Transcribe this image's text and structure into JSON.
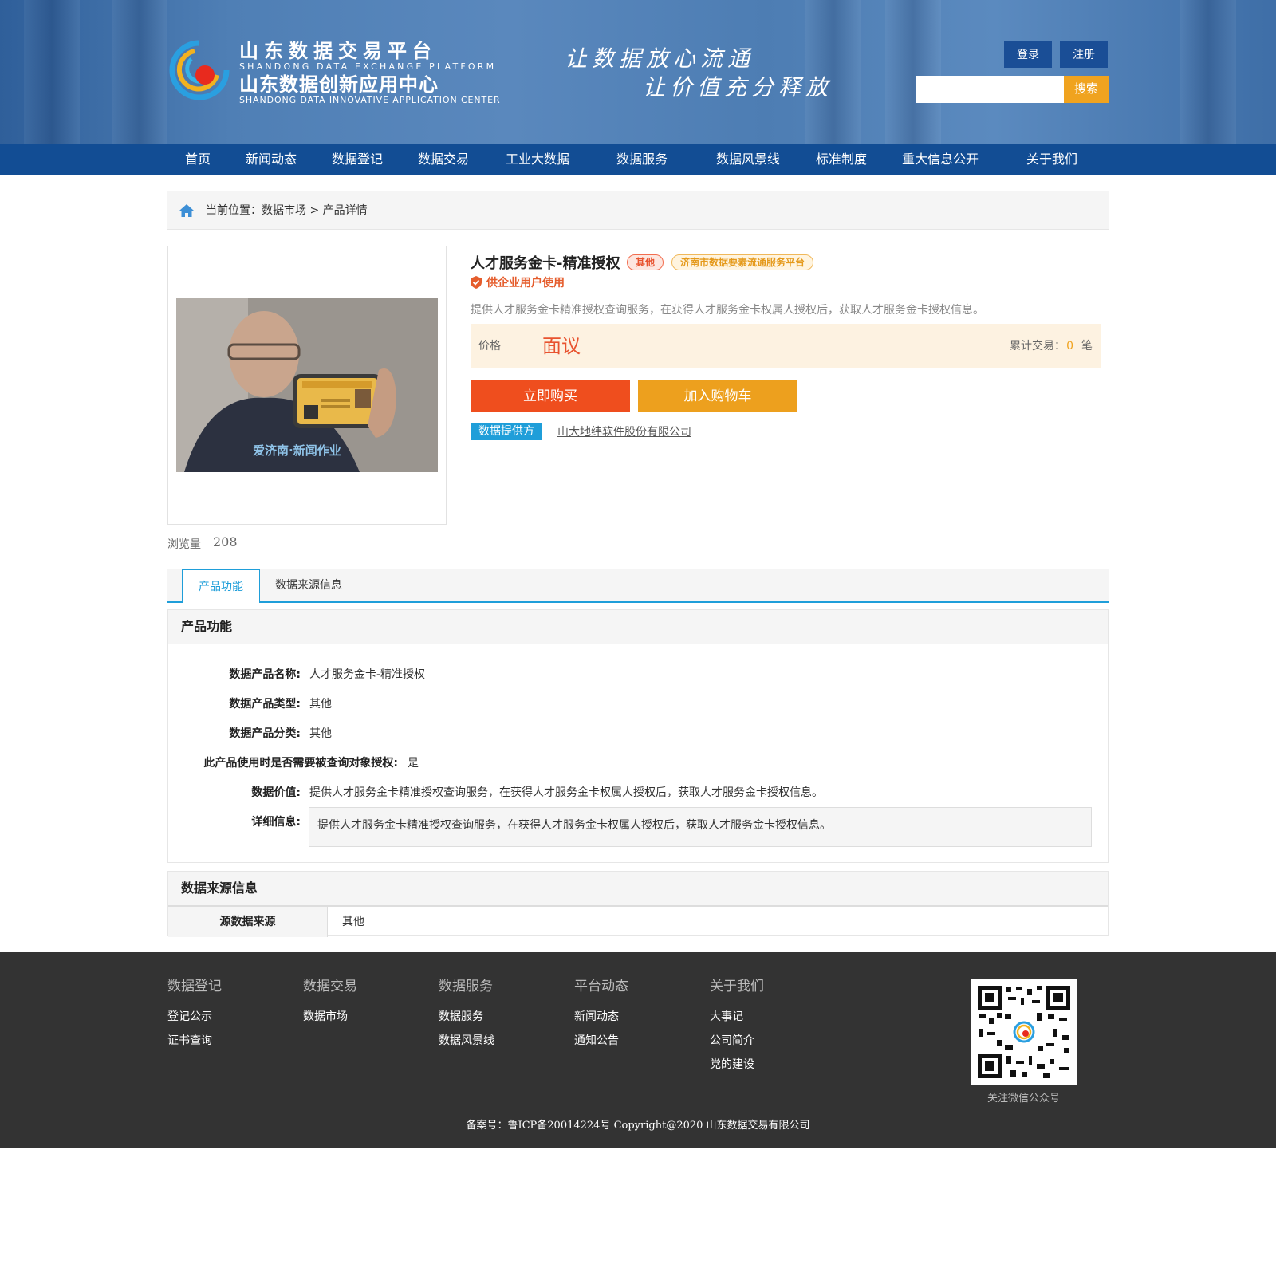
{
  "header": {
    "logo_cn_1": "山东数据交易平台",
    "logo_en_1": "SHANDONG DATA EXCHANGE PLATFORM",
    "logo_cn_2": "山东数据创新应用中心",
    "logo_en_2": "SHANDONG DATA INNOVATIVE APPLICATION CENTER",
    "slogan_1": "让数据放心流通",
    "slogan_2": "让价值充分释放",
    "login": "登录",
    "register": "注册",
    "search_button": "搜索",
    "search_placeholder": ""
  },
  "nav": [
    "首页",
    "新闻动态",
    "数据登记",
    "数据交易",
    "工业大数据",
    "数据服务",
    "数据风景线",
    "标准制度",
    "重大信息公开",
    "关于我们"
  ],
  "breadcrumb": {
    "prefix": "当前位置：",
    "market": "数据市场",
    "sep": " > ",
    "current": "产品详情"
  },
  "product": {
    "title": "人才服务金卡-精准授权",
    "tag_type": "其他",
    "tag_platform": "济南市数据要素流通服务平台",
    "usage": "供企业用户使用",
    "description": "提供人才服务金卡精准授权查询服务，在获得人才服务金卡权属人授权后，获取人才服务金卡授权信息。",
    "price_label": "价格",
    "price_value": "面议",
    "trade_label": "累计交易：",
    "trade_count": "0",
    "trade_unit": "笔",
    "buy_button": "立即购买",
    "cart_button": "加入购物车",
    "provider_label": "数据提供方",
    "provider_name": "山大地纬软件股份有限公司",
    "image_watermark": "爱济南·新闻作业",
    "views_label": "浏览量",
    "views_value": "208"
  },
  "tabs": [
    "产品功能",
    "数据来源信息"
  ],
  "function_section": {
    "title": "产品功能",
    "rows": [
      {
        "label": "数据产品名称:",
        "value": "人才服务金卡-精准授权"
      },
      {
        "label": "数据产品类型:",
        "value": "其他"
      },
      {
        "label": "数据产品分类:",
        "value": "其他"
      },
      {
        "label": "此产品使用时是否需要被查询对象授权:",
        "value": "是"
      },
      {
        "label": "数据价值:",
        "value": "提供人才服务金卡精准授权查询服务，在获得人才服务金卡权属人授权后，获取人才服务金卡授权信息。"
      },
      {
        "label": "详细信息:",
        "value": "提供人才服务金卡精准授权查询服务，在获得人才服务金卡权属人授权后，获取人才服务金卡授权信息。"
      }
    ]
  },
  "source_section": {
    "title": "数据来源信息",
    "label": "源数据来源",
    "value": "其他"
  },
  "footer": {
    "columns": [
      {
        "title": "数据登记",
        "links": [
          "登记公示",
          "证书查询"
        ]
      },
      {
        "title": "数据交易",
        "links": [
          "数据市场"
        ]
      },
      {
        "title": "数据服务",
        "links": [
          "数据服务",
          "数据风景线"
        ]
      },
      {
        "title": "平台动态",
        "links": [
          "新闻动态",
          "通知公告"
        ]
      },
      {
        "title": "关于我们",
        "links": [
          "大事记",
          "公司简介",
          "党的建设"
        ]
      }
    ],
    "qr_label": "关注微信公众号",
    "copyright": "备案号：鲁ICP备20014224号 Copyright@2020 山东数据交易有限公司"
  },
  "colors": {
    "nav_blue": "#124d94",
    "accent_orange": "#ef4e1e",
    "accent_amber": "#eda01e",
    "accent_cyan": "#1f9ed9"
  }
}
